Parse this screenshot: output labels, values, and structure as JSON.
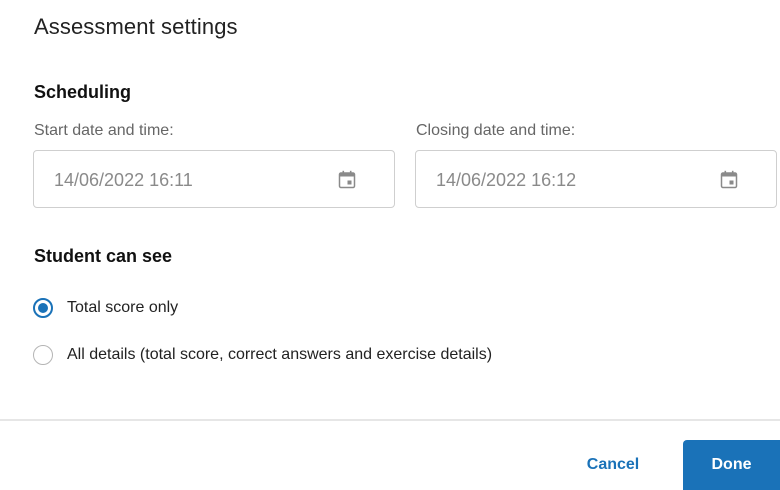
{
  "dialog": {
    "title": "Assessment settings"
  },
  "scheduling": {
    "heading": "Scheduling",
    "start": {
      "label": "Start date and time:",
      "value": "14/06/2022 16:11",
      "icon": "calendar-icon"
    },
    "closing": {
      "label": "Closing date and time:",
      "value": "14/06/2022 16:12",
      "icon": "calendar-icon"
    }
  },
  "visibility": {
    "heading": "Student can see",
    "options": [
      {
        "label": "Total score only",
        "selected": true
      },
      {
        "label": "All details (total score, correct answers and exercise details)",
        "selected": false
      }
    ]
  },
  "footer": {
    "cancel_label": "Cancel",
    "done_label": "Done"
  },
  "colors": {
    "accent": "#1a72b8",
    "muted_text": "#8a8a8a",
    "border": "#cfcfcf"
  }
}
